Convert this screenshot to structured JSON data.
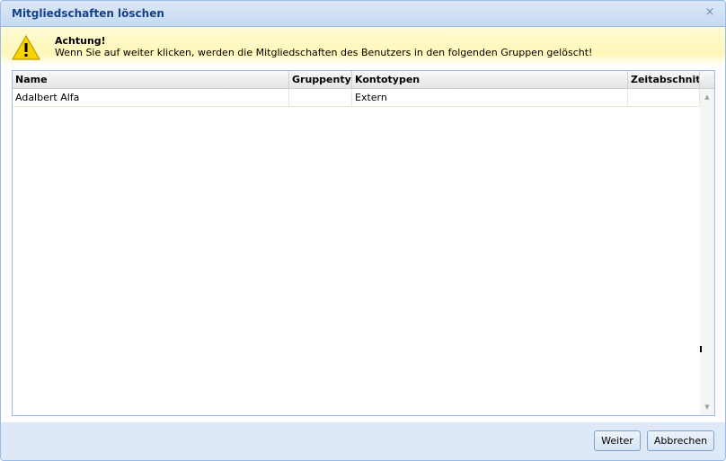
{
  "dialog": {
    "title": "Mitgliedschaften löschen",
    "close_icon": "close-icon"
  },
  "warning": {
    "icon": "warning-icon",
    "title": "Achtung!",
    "message": "Wenn Sie auf weiter klicken, werden die Mitgliedschaften des Benutzers in den folgenden Gruppen gelöscht!"
  },
  "grid": {
    "columns": [
      "Name",
      "Gruppenty",
      "Kontotypen",
      "Zeitabschnit"
    ],
    "rows": [
      [
        "Adalbert Alfa",
        "",
        "Extern",
        ""
      ]
    ]
  },
  "footer": {
    "next_label": "Weiter",
    "cancel_label": "Abbrechen"
  },
  "colors": {
    "title_text": "#15428b",
    "border": "#99bbe8",
    "warning_bg": "#fff7b8"
  }
}
